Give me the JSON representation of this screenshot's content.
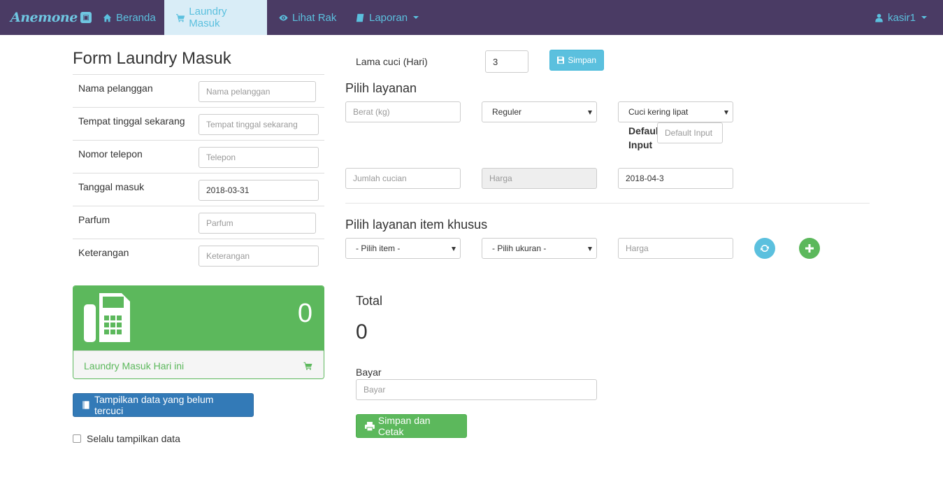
{
  "nav": {
    "brand": "Anemone",
    "items": [
      {
        "label": "Beranda",
        "icon": "home-icon"
      },
      {
        "label": "Laundry Masuk",
        "icon": "cart-icon"
      },
      {
        "label": "Lihat Rak",
        "icon": "eye-icon"
      },
      {
        "label": "Laporan",
        "icon": "book-icon"
      }
    ],
    "user": "kasir1"
  },
  "form": {
    "title": "Form Laundry Masuk",
    "rows": [
      {
        "label": "Nama pelanggan",
        "placeholder": "Nama pelanggan",
        "value": ""
      },
      {
        "label": "Tempat tinggal sekarang",
        "placeholder": "Tempat tinggal sekarang",
        "value": ""
      },
      {
        "label": "Nomor telepon",
        "placeholder": "Telepon",
        "value": ""
      },
      {
        "label": "Tanggal masuk",
        "placeholder": "",
        "value": "2018-03-31"
      },
      {
        "label": "Parfum",
        "placeholder": "Parfum",
        "value": ""
      },
      {
        "label": "Keterangan",
        "placeholder": "Keterangan",
        "value": ""
      }
    ]
  },
  "panel": {
    "count": "0",
    "footer": "Laundry Masuk Hari ini"
  },
  "buttons": {
    "show_unwashed": "Tampilkan data yang belum tercuci",
    "simpan": "Simpan",
    "simpan_cetak": "Simpan dan Cetak"
  },
  "always_show": "Selalu tampilkan data",
  "wash": {
    "label": "Lama cuci (Hari)",
    "value": "3"
  },
  "layanan": {
    "title": "Pilih layanan",
    "weight_placeholder": "Berat (kg)",
    "type_selected": "Reguler",
    "service_selected": "Cuci kering lipat",
    "default_label_1": "Defaul",
    "default_label_2": "Input",
    "default_placeholder": "Default Input",
    "qty_placeholder": "Jumlah cucian",
    "price_placeholder": "Harga",
    "date_value": "2018-04-3"
  },
  "khusus": {
    "title": "Pilih layanan item khusus",
    "item_selected": "- Pilih item -",
    "size_selected": "- Pilih ukuran -",
    "price_placeholder": "Harga"
  },
  "total": {
    "label": "Total",
    "value": "0",
    "pay_label": "Bayar",
    "pay_placeholder": "Bayar"
  },
  "colors": {
    "navbar": "#4a3b64",
    "accent": "#5bc0de",
    "success": "#5cb85c",
    "primary": "#337ab7"
  }
}
